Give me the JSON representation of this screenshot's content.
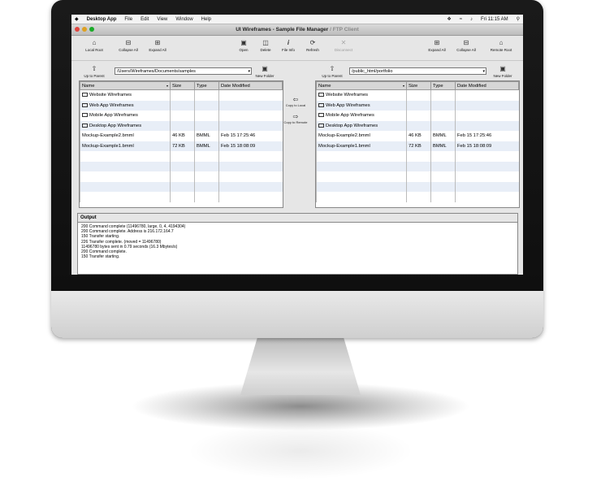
{
  "menubar": {
    "app": "Desktop App",
    "items": [
      "File",
      "Edit",
      "View",
      "Window",
      "Help"
    ],
    "clock": "Fri 11:15 AM"
  },
  "window": {
    "title_main": "UI Wireframes - Sample File Manager",
    "title_rest": " / FTP Client"
  },
  "toolbar": {
    "local_root": "Local Root",
    "collapse_all": "Collapse All",
    "expand_all": "Expand All",
    "open": "Open",
    "delete": "Delete",
    "file_info": "File Info",
    "refresh": "Refresh",
    "disconnect": "Disconnect",
    "expand_all_r": "Expand All",
    "collapse_all_r": "Collapse All",
    "remote_root": "Remote Root"
  },
  "local": {
    "up_label": "Up to Parent",
    "path": "/Users/Wireframes/Documents/samples",
    "new_folder": "New Folder",
    "columns": [
      "Name",
      "Size",
      "Type",
      "Date Modified"
    ],
    "rows": [
      {
        "name": "Website Wireframes",
        "folder": true,
        "size": "",
        "type": "",
        "date": ""
      },
      {
        "name": "Web App Wireframes",
        "folder": true,
        "size": "",
        "type": "",
        "date": ""
      },
      {
        "name": "Mobile App Wireframes",
        "folder": true,
        "size": "",
        "type": "",
        "date": ""
      },
      {
        "name": "Desktop App Wireframes",
        "folder": true,
        "size": "",
        "type": "",
        "date": ""
      },
      {
        "name": "Mockup-Example2.bmml",
        "folder": false,
        "size": "46 KB",
        "type": "BMML",
        "date": "Feb 15 17:25:46"
      },
      {
        "name": "Mockup-Example1.bmml",
        "folder": false,
        "size": "72 KB",
        "type": "BMML",
        "date": "Feb 15 18:08:09"
      }
    ]
  },
  "remote": {
    "up_label": "Up to Parent",
    "path": "/public_html/portfolio",
    "new_folder": "New Folder",
    "columns": [
      "Name",
      "Size",
      "Type",
      "Date Modified"
    ],
    "rows": [
      {
        "name": "Website Wireframes",
        "folder": true,
        "size": "",
        "type": "",
        "date": ""
      },
      {
        "name": "Web App Wireframes",
        "folder": true,
        "size": "",
        "type": "",
        "date": ""
      },
      {
        "name": "Mobile App Wireframes",
        "folder": true,
        "size": "",
        "type": "",
        "date": ""
      },
      {
        "name": "Desktop App Wireframes",
        "folder": true,
        "size": "",
        "type": "",
        "date": ""
      },
      {
        "name": "Mockup-Example2.bmml",
        "folder": false,
        "size": "46 KB",
        "type": "BMML",
        "date": "Feb 15 17:25:46"
      },
      {
        "name": "Mockup-Example1.bmml",
        "folder": false,
        "size": "72 KB",
        "type": "BMML",
        "date": "Feb 15 18:08:09"
      }
    ]
  },
  "transfer": {
    "copy_local": "Copy to Local",
    "copy_remote": "Copy to Remote"
  },
  "output": {
    "title": "Output",
    "lines": [
      "200 Command complete (11496780, large, 0, 4, 4194304)",
      "200 Command complete. Address is 216.172.164.7",
      "150 Transfer starting.",
      "226 Transfer complete. (moved = 11496780)",
      "11496780 bytes sent in 0.79 seconds (16.3 Mbytes/s)",
      "200 Command complete.",
      "150 Transfer starting."
    ]
  },
  "colors": {
    "bezel": "#111111",
    "row_alt": "#e8eef7"
  }
}
